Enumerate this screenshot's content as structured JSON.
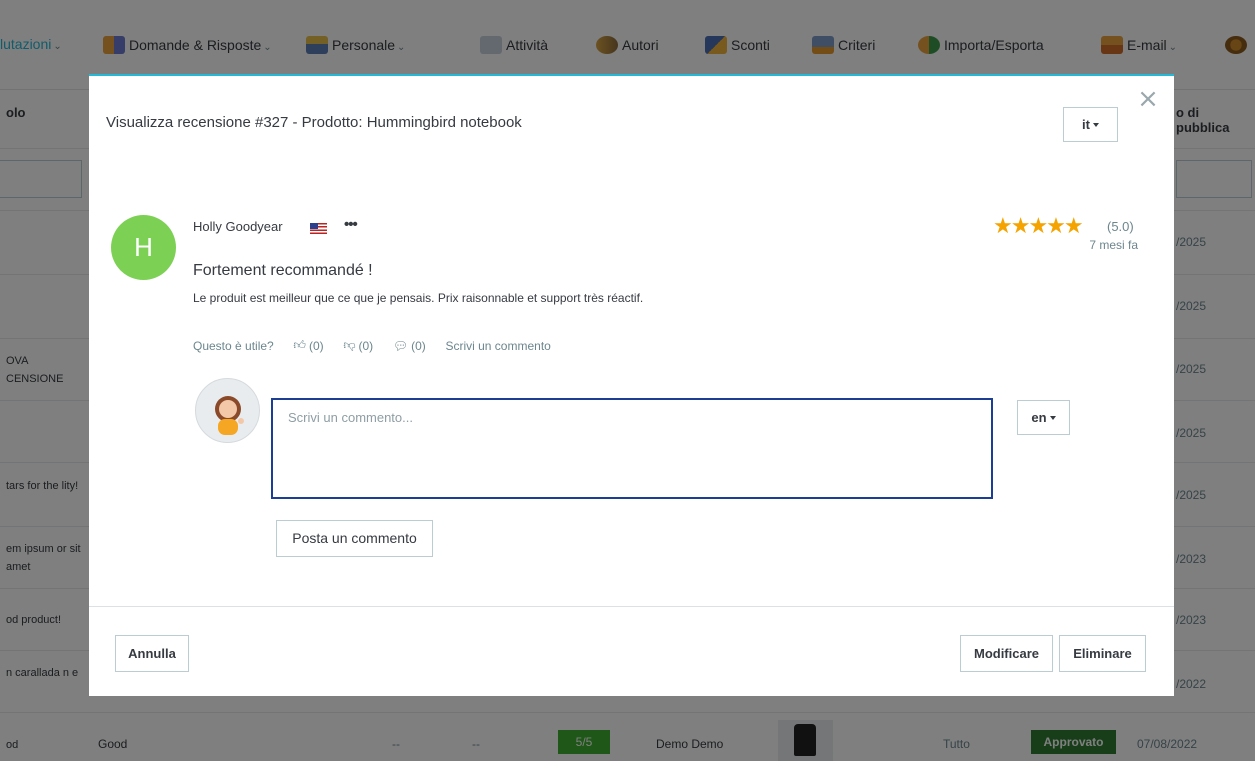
{
  "nav": {
    "items": [
      {
        "label": "lutazioni",
        "caret": "⌄"
      },
      {
        "label": "Domande & Risposte",
        "caret": "⌄"
      },
      {
        "label": "Personale",
        "caret": "⌄"
      },
      {
        "label": "Attività"
      },
      {
        "label": "Autori"
      },
      {
        "label": "Sconti"
      },
      {
        "label": "Criteri"
      },
      {
        "label": "Importa/Esporta"
      },
      {
        "label": "E-mail",
        "caret": "⌄"
      }
    ]
  },
  "table": {
    "header_left": "olo",
    "header_right": "o di pubblica",
    "rows": [
      {
        "title": "",
        "date": "/2025"
      },
      {
        "title": "",
        "date": "/2025"
      },
      {
        "title": "OVA CENSIONE",
        "date": "/2025"
      },
      {
        "title": "",
        "date": "/2025"
      },
      {
        "title": "tars for the lity!",
        "date": "/2025"
      },
      {
        "title": "em ipsum or sit amet",
        "date": "/2023"
      },
      {
        "title": "od product!",
        "date": "/2023"
      },
      {
        "title": "n carallada n e",
        "date": "/2022"
      }
    ],
    "last_row": {
      "title": "od",
      "col2": "Good",
      "col3": "--",
      "col4": "--",
      "score": "5/5",
      "author": "Demo Demo",
      "scope": "Tutto",
      "status": "Approvato",
      "date": "07/08/2022"
    }
  },
  "modal": {
    "title": "Visualizza recensione #327 - Prodotto: Hummingbird notebook",
    "lang_selected": "it",
    "close_symbol": "×",
    "review": {
      "avatar_letter": "H",
      "author": "Holly Goodyear",
      "more": "•••",
      "title": "Fortement recommandé !",
      "text": "Le produit est meilleur que ce que je pensais. Prix raisonnable et support très réactif.",
      "stars": "★★★★★",
      "rating": 5.0,
      "rating_label": "(5.0)",
      "time_ago": "7 mesi fa"
    },
    "useful": {
      "question": "Questo è utile?",
      "likes": "(0)",
      "dislikes": "(0)",
      "comments": "(0)",
      "write_comment": "Scrivi un commento"
    },
    "comment": {
      "placeholder": "Scrivi un commento...",
      "value": "",
      "lang": "en",
      "post_label": "Posta un commento"
    },
    "footer": {
      "cancel": "Annulla",
      "edit": "Modificare",
      "delete": "Eliminare"
    }
  },
  "colors": {
    "accent": "#25b9d7",
    "avatar": "#7cd054",
    "star": "#f4a300",
    "focus_border": "#1c3f94",
    "approved": "#2e7d32",
    "score_badge": "#3cae2f"
  }
}
